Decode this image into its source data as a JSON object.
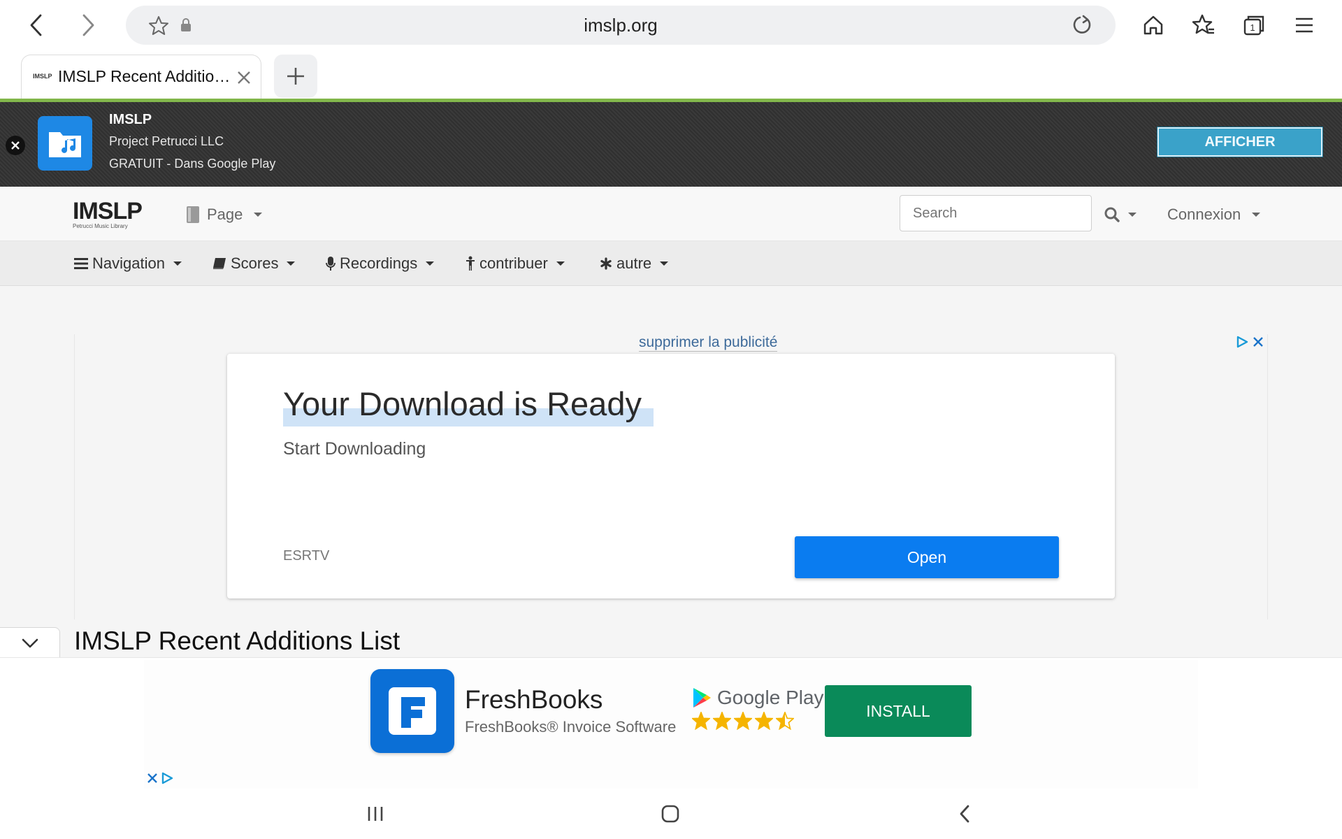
{
  "browser": {
    "url": "imslp.org",
    "tab_title": "IMSLP Recent Additio…",
    "tab_favicon_text": "IMSLP",
    "tab_count": "1"
  },
  "app_banner": {
    "title": "IMSLP",
    "developer": "Project Petrucci LLC",
    "price_store": "GRATUIT - Dans Google Play",
    "button_label": "AFFICHER"
  },
  "site_header": {
    "logo_text": "IMSLP",
    "logo_subtext": "Petrucci Music Library",
    "page_menu_label": "Page",
    "search_placeholder": "Search",
    "login_label": "Connexion"
  },
  "nav": {
    "items": [
      {
        "label": "Navigation",
        "icon": "bars-icon"
      },
      {
        "label": "Scores",
        "icon": "book-icon"
      },
      {
        "label": "Recordings",
        "icon": "microphone-icon"
      },
      {
        "label": "contribuer",
        "icon": "person-icon"
      },
      {
        "label": "autre",
        "icon": "asterisk-icon"
      }
    ]
  },
  "ad_top": {
    "remove_label": "supprimer la publicité",
    "headline": "Your Download is Ready",
    "subtitle": "Start Downloading",
    "brand": "ESRTV",
    "cta": "Open"
  },
  "page": {
    "heading": "IMSLP Recent Additions List"
  },
  "ad_bottom": {
    "app_name": "FreshBooks",
    "tagline": "FreshBooks® Invoice Software",
    "store": "Google Play",
    "rating": 4.5,
    "cta": "INSTALL"
  },
  "colors": {
    "accent_green": "#82b74b",
    "banner_button": "#3aa2c9",
    "open_button": "#0a7cf0",
    "install_button": "#0a8a59",
    "freshbooks_blue": "#0b6fd6"
  }
}
